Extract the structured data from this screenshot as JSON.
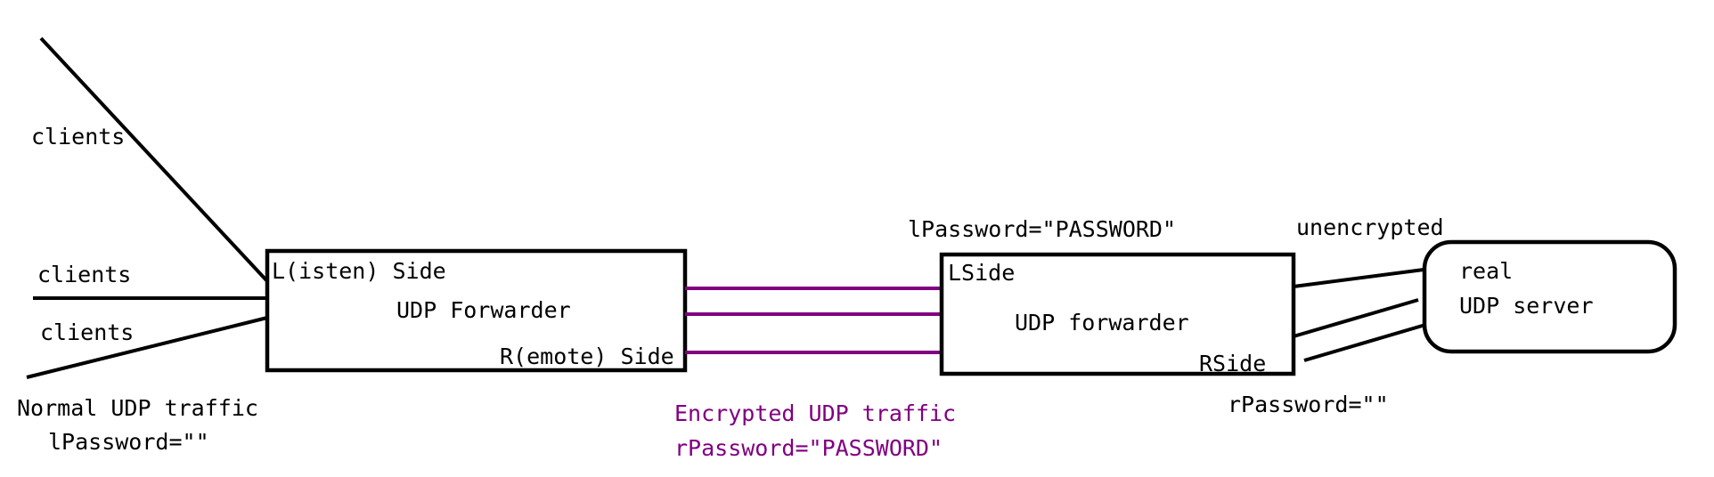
{
  "diagram": {
    "colors": {
      "stroke": "#000000",
      "encrypted": "#800080",
      "background": "#ffffff"
    },
    "clients": {
      "top_label": "clients",
      "middle_label": "clients",
      "bottom_label": "clients"
    },
    "left_side": {
      "normal_traffic_label": "Normal UDP traffic",
      "password_label": "lPassword=\"\""
    },
    "forwarder_1": {
      "listen_side_label": "L(isten) Side",
      "title": "UDP Forwarder",
      "remote_side_label": "R(emote) Side"
    },
    "tunnel": {
      "encrypted_label": "Encrypted UDP traffic",
      "password_label": "rPassword=\"PASSWORD\""
    },
    "forwarder_2": {
      "password_label": "lPassword=\"PASSWORD\"",
      "lside_label": "LSide",
      "title": "UDP forwarder",
      "rside_label": "RSide",
      "rpassword_label": "rPassword=\"\""
    },
    "server": {
      "unencrypted_label": "unencrypted",
      "line1": "real",
      "line2": "UDP server"
    }
  }
}
